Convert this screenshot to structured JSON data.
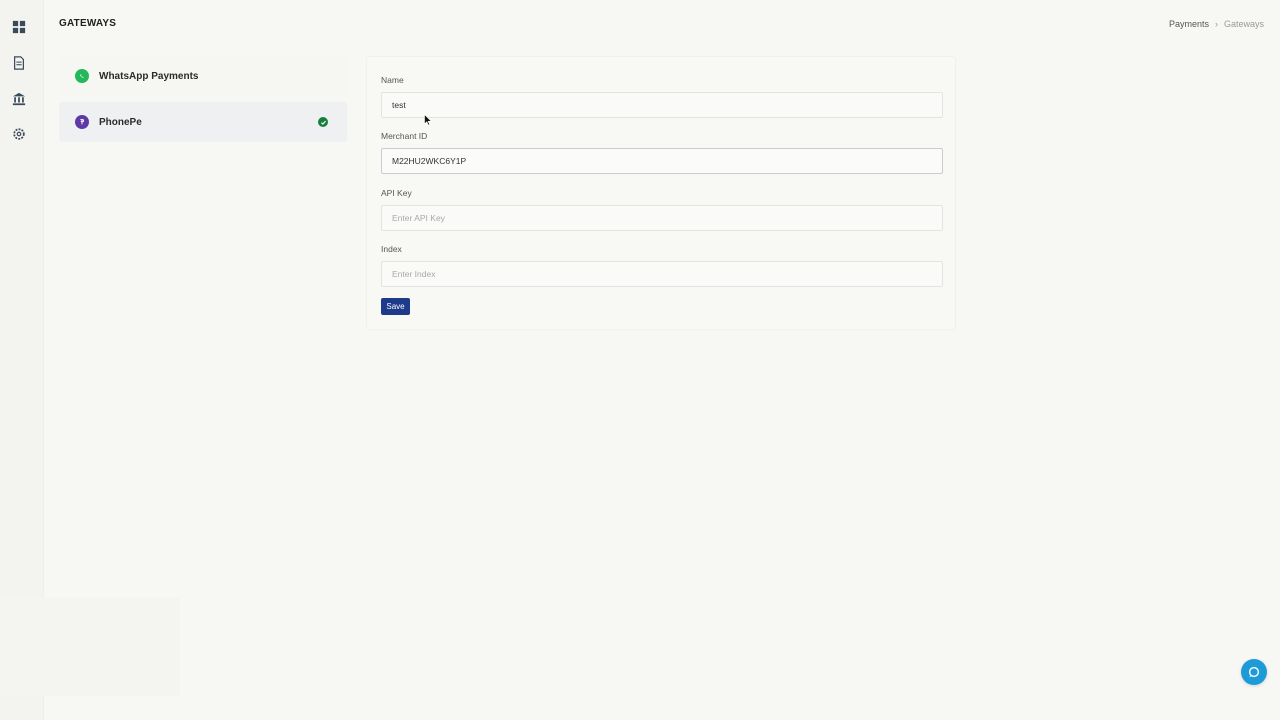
{
  "header": {
    "title": "GATEWAYS",
    "breadcrumb": {
      "parent": "Payments",
      "separator": "›",
      "current": "Gateways"
    }
  },
  "sidebar_rail": {
    "icons": [
      "dashboard-icon",
      "document-icon",
      "bank-icon",
      "settings-icon"
    ]
  },
  "gateways": {
    "items": [
      {
        "label": "WhatsApp Payments",
        "icon": "whatsapp-icon",
        "icon_color": "#25b85a",
        "active": false
      },
      {
        "label": "PhonePe",
        "icon": "phonepe-icon",
        "icon_color": "#5f3aa7",
        "active": true,
        "status": "enabled"
      }
    ]
  },
  "form": {
    "name": {
      "label": "Name",
      "value": "test",
      "placeholder": ""
    },
    "merchant_id": {
      "label": "Merchant ID",
      "value": "M22HU2WKC6Y1P",
      "placeholder": ""
    },
    "api_key": {
      "label": "API Key",
      "value": "",
      "placeholder": "Enter API Key"
    },
    "index": {
      "label": "Index",
      "value": "",
      "placeholder": "Enter Index"
    },
    "save_label": "Save"
  },
  "colors": {
    "primary_button": "#1e3a8a",
    "status_ok": "#15803d",
    "help_fab": "#1d9bd8"
  }
}
